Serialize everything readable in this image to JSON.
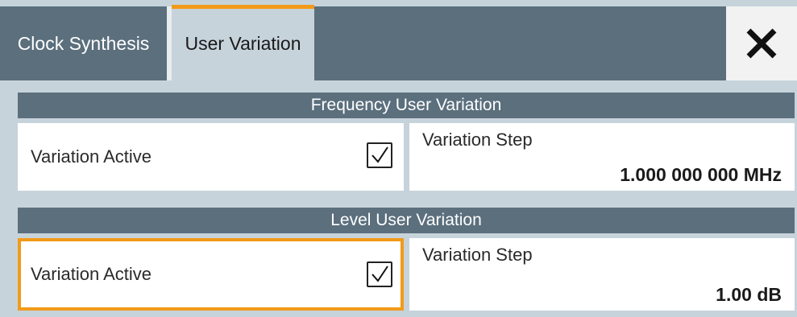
{
  "tabs": [
    {
      "label": "Clock Synthesis",
      "active": false
    },
    {
      "label": "User Variation",
      "active": true
    }
  ],
  "close_icon": "close-icon",
  "frequency": {
    "header": "Frequency User Variation",
    "variation_active_label": "Variation Active",
    "variation_active_checked": true,
    "step_label": "Variation Step",
    "step_value": "1.000 000 000 MHz"
  },
  "level": {
    "header": "Level User Variation",
    "variation_active_label": "Variation Active",
    "variation_active_checked": true,
    "step_label": "Variation Step",
    "step_value": "1.00 dB"
  },
  "colors": {
    "accent": "#f29a1a",
    "header_bg": "#5b6f7d",
    "panel_bg": "#c7d3db"
  }
}
